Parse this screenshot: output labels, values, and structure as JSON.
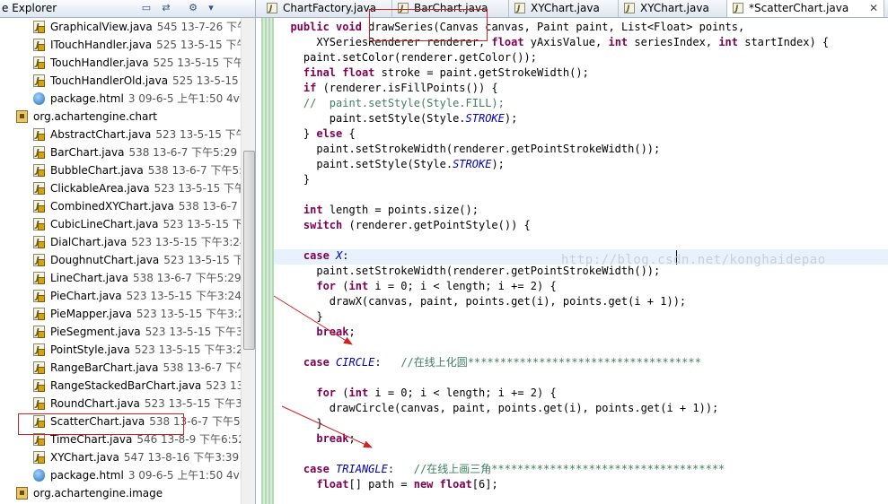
{
  "explorer": {
    "title": "e Explorer",
    "items": [
      {
        "icon": "java",
        "name": "GraphicalView.java",
        "meta": "545  13-7-26 下午"
      },
      {
        "icon": "java",
        "name": "ITouchHandler.java",
        "meta": "525  13-5-15 下午"
      },
      {
        "icon": "java",
        "name": "TouchHandler.java",
        "meta": "525  13-5-15 下午"
      },
      {
        "icon": "java",
        "name": "TouchHandlerOld.java",
        "meta": "525  13-5-15 "
      },
      {
        "icon": "html",
        "name": "package.html",
        "meta": "3  09-6-5 上午1:50  4vi"
      },
      {
        "icon": "pkg",
        "name": "org.achartengine.chart",
        "meta": ""
      },
      {
        "icon": "java",
        "name": "AbstractChart.java",
        "meta": "523  13-5-15 下午"
      },
      {
        "icon": "java",
        "name": "BarChart.java",
        "meta": "538  13-6-7 下午5:29  c"
      },
      {
        "icon": "java",
        "name": "BubbleChart.java",
        "meta": "538  13-6-7 下午5:2"
      },
      {
        "icon": "java",
        "name": "ClickableArea.java",
        "meta": "523  13-5-15 下午"
      },
      {
        "icon": "java",
        "name": "CombinedXYChart.java",
        "meta": "538  13-6-7 "
      },
      {
        "icon": "java",
        "name": "CubicLineChart.java",
        "meta": "523  13-5-15 下午"
      },
      {
        "icon": "java",
        "name": "DialChart.java",
        "meta": "523  13-5-15 下午3:24"
      },
      {
        "icon": "java",
        "name": "DoughnutChart.java",
        "meta": "523  13-5-15 下午"
      },
      {
        "icon": "java",
        "name": "LineChart.java",
        "meta": "538  13-6-7 下午5:29"
      },
      {
        "icon": "java",
        "name": "PieChart.java",
        "meta": "523  13-5-15 下午3:24"
      },
      {
        "icon": "java",
        "name": "PieMapper.java",
        "meta": "523  13-5-15 下午3:2"
      },
      {
        "icon": "java",
        "name": "PieSegment.java",
        "meta": "523  13-5-15 下午3:"
      },
      {
        "icon": "java",
        "name": "PointStyle.java",
        "meta": "523  13-5-15 下午3:24"
      },
      {
        "icon": "java",
        "name": "RangeBarChart.java",
        "meta": "538  13-6-7 下午"
      },
      {
        "icon": "java",
        "name": "RangeStackedBarChart.java",
        "meta": "523  13-"
      },
      {
        "icon": "java",
        "name": "RoundChart.java",
        "meta": "523  13-5-15 下午3:"
      },
      {
        "icon": "java",
        "name": "ScatterChart.java",
        "meta": "538  13-6-7 下午5:2"
      },
      {
        "icon": "java",
        "name": "TimeChart.java",
        "meta": "546  13-8-9 下午6:52"
      },
      {
        "icon": "java",
        "name": "XYChart.java",
        "meta": "547  13-8-16 下午3:39"
      },
      {
        "icon": "html",
        "name": "package.html",
        "meta": "3  09-6-5 上午1:50  4vi"
      },
      {
        "icon": "pkg",
        "name": "org.achartengine.image",
        "meta": ""
      }
    ]
  },
  "tabs": [
    {
      "label": "ChartFactory.java",
      "active": false
    },
    {
      "label": "BarChart.java",
      "active": false
    },
    {
      "label": "XYChart.java",
      "active": false
    },
    {
      "label": "XYChart.java",
      "active": false
    },
    {
      "label": "*ScatterChart.java",
      "active": true,
      "close": "✕"
    }
  ],
  "watermark": "http://blog.csdn.net/konghaidepao",
  "code_lines": [
    "  public void drawSeries(Canvas canvas, Paint paint, List<Float> points,",
    "      XYSeriesRenderer renderer, float yAxisValue, int seriesIndex, int startIndex) {",
    "    paint.setColor(renderer.getColor());",
    "    final float stroke = paint.getStrokeWidth();",
    "    if (renderer.isFillPoints()) {",
    "    //  paint.setStyle(Style.FILL);",
    "        paint.setStyle(Style.STROKE);",
    "    } else {",
    "      paint.setStrokeWidth(renderer.getPointStrokeWidth());",
    "      paint.setStyle(Style.STROKE);",
    "    }",
    "",
    "    int length = points.size();",
    "    switch (renderer.getPointStyle()) {",
    "",
    "    case X:",
    "      paint.setStrokeWidth(renderer.getPointStrokeWidth());",
    "      for (int i = 0; i < length; i += 2) {",
    "        drawX(canvas, paint, points.get(i), points.get(i + 1));",
    "      }",
    "      break;",
    "",
    "    case CIRCLE:   //在线上化圆************************************",
    "",
    "      for (int i = 0; i < length; i += 2) {",
    "        drawCircle(canvas, paint, points.get(i), points.get(i + 1));",
    "      }",
    "      break;",
    "",
    "    case TRIANGLE:   //在线上画三角************************************",
    "      float[] path = new float[6];"
  ],
  "colors": {
    "highlight_box": "#d32020",
    "arrow": "#d32020",
    "keyword": "#7f0055",
    "comment": "#3f7f5f",
    "constant": "#0000c0"
  }
}
